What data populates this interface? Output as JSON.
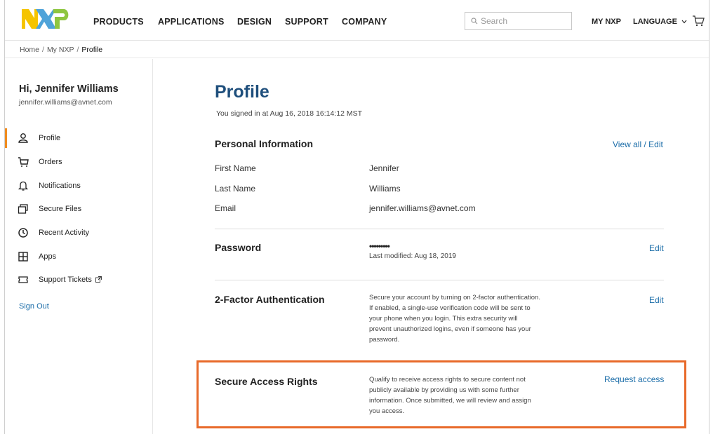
{
  "header": {
    "logo_alt": "NXP",
    "nav": [
      "PRODUCTS",
      "APPLICATIONS",
      "DESIGN",
      "SUPPORT",
      "COMPANY"
    ],
    "search_placeholder": "Search",
    "my_nxp": "MY NXP",
    "language": "LANGUAGE",
    "brand_colors": {
      "yellow": "#f5c400",
      "blue": "#4fa3d9",
      "green": "#8ec640"
    }
  },
  "breadcrumb": {
    "home": "Home",
    "my_nxp": "My NXP",
    "current": "Profile"
  },
  "sidebar": {
    "greeting": "Hi, Jennifer Williams",
    "email": "jennifer.williams@avnet.com",
    "items": [
      {
        "label": "Profile",
        "icon": "user-icon"
      },
      {
        "label": "Orders",
        "icon": "cart-icon"
      },
      {
        "label": "Notifications",
        "icon": "bell-icon"
      },
      {
        "label": "Secure Files",
        "icon": "folder-icon"
      },
      {
        "label": "Recent Activity",
        "icon": "clock-icon"
      },
      {
        "label": "Apps",
        "icon": "grid-icon"
      },
      {
        "label": "Support Tickets",
        "icon": "ticket-icon"
      }
    ],
    "sign_out": "Sign Out",
    "active_color": "#f08c1f"
  },
  "main": {
    "title": "Profile",
    "signed_in": "You signed in at Aug 16, 2018 16:14:12 MST",
    "personal": {
      "heading": "Personal Information",
      "action": "View all / Edit",
      "rows": [
        {
          "label": "First Name",
          "value": "Jennifer"
        },
        {
          "label": "Last Name",
          "value": "Williams"
        },
        {
          "label": "Email",
          "value": "jennifer.williams@avnet.com"
        }
      ]
    },
    "password": {
      "heading": "Password",
      "masked": "•••••••••",
      "last_modified": "Last modified: Aug 18, 2019",
      "action": "Edit"
    },
    "two_factor": {
      "heading": "2-Factor Authentication",
      "lines": [
        "Secure your account by turning on 2-factor authentication.",
        "If enabled, a single-use verification code will be sent to",
        "your phone when you login. This extra security will",
        "prevent unauthorized logins, even if someone has your",
        "password."
      ],
      "action": "Edit"
    },
    "secure_access": {
      "heading": "Secure Access Rights",
      "lines": [
        "Qualify to receive access rights to secure content not",
        "publicly available by providing us with some further",
        "information. Once submitted, we will review and assign",
        "you access."
      ],
      "action": "Request access",
      "highlight_color": "#e86a2a"
    },
    "link_color": "#1a6ca8",
    "title_color": "#1f4f7c"
  }
}
